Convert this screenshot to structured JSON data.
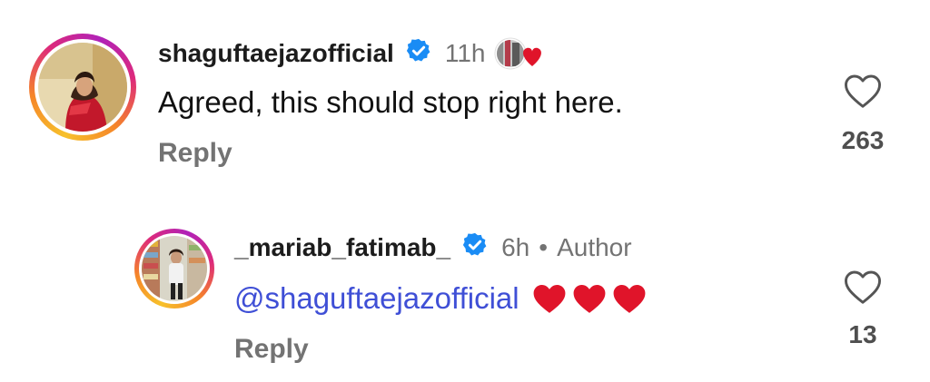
{
  "comments": [
    {
      "username": "shaguftaejazofficial",
      "time": "11h",
      "text": "Agreed, this should stop right here.",
      "reply_label": "Reply",
      "likes": "263",
      "avatar_icon": "profile-photo",
      "liked_by_author": true
    },
    {
      "username": "_mariab_fatimab_",
      "time": "6h",
      "separator": "•",
      "author_label": "Author",
      "mention": "@shaguftaejazofficial",
      "emojis": [
        "red-heart",
        "red-heart",
        "red-heart"
      ],
      "reply_label": "Reply",
      "likes": "13",
      "avatar_icon": "profile-photo"
    }
  ],
  "colors": {
    "verified": "#1a8cf5",
    "mention": "#3f4fd6",
    "heart_red": "#e0142a",
    "muted": "#737373"
  }
}
